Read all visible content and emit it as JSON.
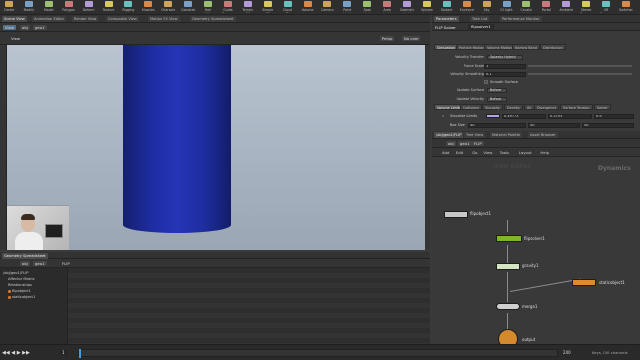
{
  "shelf": {
    "items": [
      {
        "label": "Create"
      },
      {
        "label": "Modify"
      },
      {
        "label": "Model"
      },
      {
        "label": "Polygon"
      },
      {
        "label": "Deform"
      },
      {
        "label": "Texture"
      },
      {
        "label": "Rigging"
      },
      {
        "label": "Muscles"
      },
      {
        "label": "Characters"
      },
      {
        "label": "Constraints"
      },
      {
        "label": "Hair Utils"
      },
      {
        "label": "Guide Process"
      },
      {
        "label": "Terrain FX"
      },
      {
        "label": "Simple FX"
      },
      {
        "label": "Cloud FX"
      },
      {
        "label": "Volume"
      },
      {
        "label": "Camera"
      },
      {
        "label": "Point Light"
      },
      {
        "label": "Spot Light"
      },
      {
        "label": "Area Light"
      },
      {
        "label": "Geometry Light"
      },
      {
        "label": "Volume Light"
      },
      {
        "label": "Distant Light"
      },
      {
        "label": "Environment Light"
      },
      {
        "label": "Sky Light"
      },
      {
        "label": "GI Light"
      },
      {
        "label": "Caustic Light"
      },
      {
        "label": "Portal Light"
      },
      {
        "label": "Ambient Light"
      },
      {
        "label": "Stereo Camera"
      },
      {
        "label": "VR Camera"
      },
      {
        "label": "Switcher"
      }
    ]
  },
  "left_tabs": [
    "Scene View",
    "Animation Editor",
    "Render View",
    "Composite View",
    "Motion FX View",
    "Geometry Spreadsheet"
  ],
  "viewport": {
    "pane_title": "View",
    "path": [
      "obj",
      "geo1"
    ],
    "path_right": [
      "Persp",
      "No cam"
    ]
  },
  "spreadsheet": {
    "tab": "Geometry Spreadsheet",
    "path": [
      "obj",
      "geo1"
    ],
    "node_label": "FLIP",
    "tree": [
      {
        "label": "/obj/geo1/FLIP"
      },
      {
        "label": "Affector Matrix"
      },
      {
        "label": "Relationships"
      },
      {
        "label": "flipobject1"
      },
      {
        "label": "staticobject1"
      }
    ]
  },
  "right_tabs": [
    "Parameters",
    "Take List",
    "Performance Monitor"
  ],
  "params": {
    "node_type": "FLIP Solver",
    "node_name": "flipsolver1",
    "subtabs_top": [
      "Simulation",
      "Particle Motion",
      "Volume Motion",
      "Narrow Band",
      "Distribution"
    ],
    "velocity_transfer_label": "Velocity Transfer",
    "velocity_transfer_value": "Splashy Hybrid",
    "force_scale_label": "Force Scale",
    "force_scale_value": "1",
    "vel_smoothing_label": "Velocity Smoothing",
    "vel_smoothing_value": "0.1",
    "smooth_surface_label": "Smooth Surface",
    "update_surface_label": "Update Surface",
    "update_surface_value": "Before",
    "update_velocity_label": "Update Velocity",
    "update_velocity_value": "Before",
    "subtabs_bottom": [
      "Volume Limits",
      "Collisions",
      "Viscosity",
      "Density",
      "Air",
      "Divergence",
      "Surface Tension",
      "Solver"
    ],
    "visualize_limits_label": "Visualize Limits",
    "box_size_label": "Box Size",
    "limit_values": [
      "0.49773",
      "0.3753",
      "0.9"
    ],
    "box_values": [
      "50",
      "50",
      "50"
    ]
  },
  "network": {
    "tabs": [
      "/obj/geo1/FLIP",
      "Tree View",
      "Material Palette",
      "Asset Browser"
    ],
    "path": [
      "obj",
      "geo1",
      "FLIP"
    ],
    "menu": [
      "Add",
      "Edit",
      "Go",
      "View",
      "Tools",
      "Layout",
      "Help"
    ],
    "context_label": "Dynamics",
    "watermark": "Indie Edition",
    "nodes": {
      "flipobject1": "flipobject1",
      "flipsolver1": "flipsolver1",
      "gravity1": "gravity1",
      "merge1": "merge1",
      "staticobject1": "staticobject1",
      "output": "output"
    }
  },
  "timeline": {
    "current_frame": "1",
    "start": "1",
    "end": "240",
    "status": "Keys, 0/0 channels"
  },
  "colors": {
    "fluid": "#1f2ea8",
    "solver_node": "#7fb52a",
    "gravity_node": "#d5e4c1",
    "static_node": "#e08a2e",
    "output_node": "#d4892d",
    "visualize_swatch": "#b8a2e6"
  }
}
